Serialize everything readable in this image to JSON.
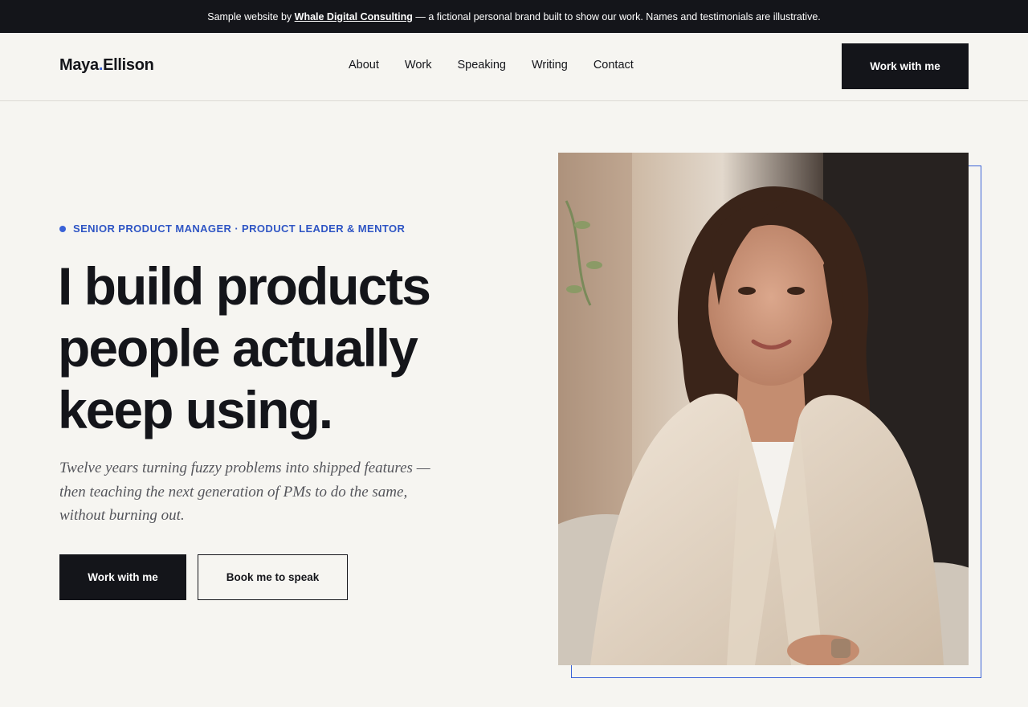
{
  "banner": {
    "prefix": "Sample website by",
    "link": "Whale Digital Consulting",
    "suffix": "— a fictional personal brand built to show our work. Names and testimonials are illustrative."
  },
  "brand": {
    "first": "Maya",
    "dot": ".",
    "last": "Ellison",
    "accent_color": "#3a62d7"
  },
  "nav": {
    "items": [
      {
        "label": "About"
      },
      {
        "label": "Work"
      },
      {
        "label": "Speaking"
      },
      {
        "label": "Writing"
      },
      {
        "label": "Contact"
      }
    ],
    "cta": "Work with me"
  },
  "hero": {
    "eyebrow": "SENIOR PRODUCT MANAGER · PRODUCT LEADER & MENTOR",
    "headline": [
      "I build products",
      "people actually",
      "keep using."
    ],
    "subtext": [
      "Twelve years turning fuzzy problems into shipped features —",
      "then teaching the next generation of PMs to do the same,",
      "without burning out."
    ],
    "primary_cta": "Work with me",
    "secondary_cta": "Book me to speak",
    "photo_subject": "portrait-photo"
  },
  "colors": {
    "dark": "#14151a",
    "accent": "#3a62d7",
    "background": "#f6f5f1"
  }
}
